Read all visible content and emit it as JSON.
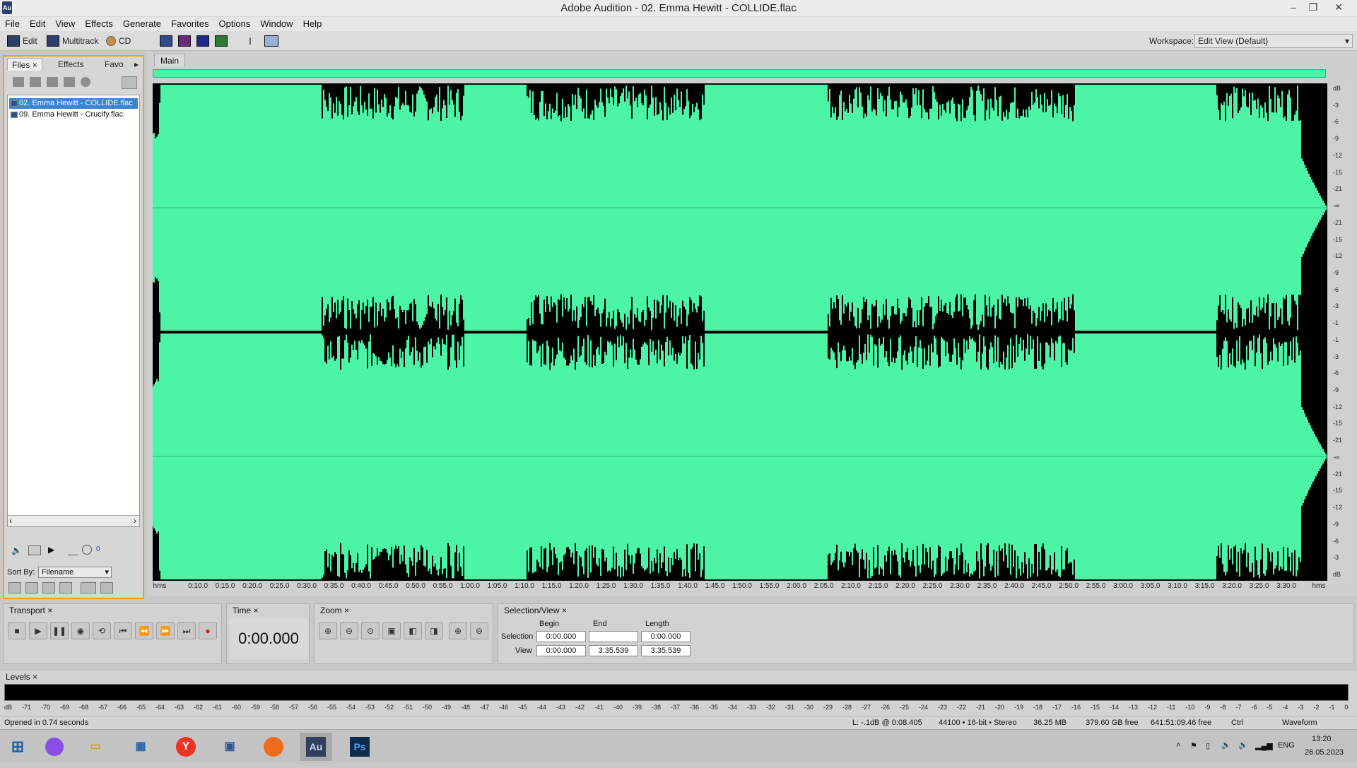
{
  "window": {
    "title": "Adobe Audition - 02. Emma Hewitt - COLLIDE.flac",
    "app_badge": "Au"
  },
  "menu": [
    "File",
    "Edit",
    "View",
    "Effects",
    "Generate",
    "Favorites",
    "Options",
    "Window",
    "Help"
  ],
  "toolbar": {
    "edit_label": "Edit",
    "multitrack_label": "Multitrack",
    "cd_label": "CD",
    "workspace_label": "Workspace:",
    "workspace_value": "Edit View (Default)"
  },
  "files_panel": {
    "tabs": [
      "Files",
      "Effects",
      "Favo"
    ],
    "files": [
      "02. Emma Hewitt - COLLIDE.flac",
      "09. Emma Hewitt - Crucify.flac"
    ],
    "sort_label": "Sort By:",
    "sort_value": "Filename",
    "volume_value": "0"
  },
  "main": {
    "tab": "Main",
    "db_ticks": [
      "dB",
      "-3",
      "-6",
      "-9",
      "-12",
      "-15",
      "-21",
      "-∞",
      "-21",
      "-15",
      "-12",
      "-9",
      "-6",
      "-3",
      "-1",
      "-1",
      "-3",
      "-6",
      "-9",
      "-12",
      "-15",
      "-21",
      "-∞",
      "-21",
      "-15",
      "-12",
      "-9",
      "-6",
      "-3",
      "dB"
    ],
    "time_ticks": [
      "hms",
      "0:10.0",
      "0:15.0",
      "0:20.0",
      "0:25.0",
      "0:30.0",
      "0:35.0",
      "0:40.0",
      "0:45.0",
      "0:50.0",
      "0:55.0",
      "1:00.0",
      "1:05.0",
      "1:10.0",
      "1:15.0",
      "1:20.0",
      "1:25.0",
      "1:30.0",
      "1:35.0",
      "1:40.0",
      "1:45.0",
      "1:50.0",
      "1:55.0",
      "2:00.0",
      "2:05.0",
      "2:10.0",
      "2:15.0",
      "2:20.0",
      "2:25.0",
      "2:30.0",
      "2:35.0",
      "2:40.0",
      "2:45.0",
      "2:50.0",
      "2:55.0",
      "3:00.0",
      "3:05.0",
      "3:10.0",
      "3:15.0",
      "3:20.0",
      "3:25.0",
      "3:30.0",
      "hms"
    ],
    "wave_color": "#4cf5a6"
  },
  "transport": {
    "title": "Transport"
  },
  "time": {
    "title": "Time",
    "value": "0:00.000"
  },
  "zoom": {
    "title": "Zoom"
  },
  "selection": {
    "title": "Selection/View",
    "col_begin": "Begin",
    "col_end": "End",
    "col_length": "Length",
    "row_selection": "Selection",
    "row_view": "View",
    "sel_begin": "0:00.000",
    "sel_end": "",
    "sel_length": "0:00.000",
    "view_begin": "0:00.000",
    "view_end": "3:35.539",
    "view_length": "3:35.539"
  },
  "levels": {
    "title": "Levels",
    "scale": [
      "dB",
      "-71",
      "-70",
      "-69",
      "-68",
      "-67",
      "-66",
      "-65",
      "-64",
      "-63",
      "-62",
      "-61",
      "-60",
      "-59",
      "-58",
      "-57",
      "-56",
      "-55",
      "-54",
      "-53",
      "-52",
      "-51",
      "-50",
      "-49",
      "-48",
      "-47",
      "-46",
      "-45",
      "-44",
      "-43",
      "-42",
      "-41",
      "-40",
      "-39",
      "-38",
      "-37",
      "-36",
      "-35",
      "-34",
      "-33",
      "-32",
      "-31",
      "-30",
      "-29",
      "-28",
      "-27",
      "-26",
      "-25",
      "-24",
      "-23",
      "-22",
      "-21",
      "-20",
      "-19",
      "-18",
      "-17",
      "-16",
      "-15",
      "-14",
      "-13",
      "-12",
      "-11",
      "-10",
      "-9",
      "-8",
      "-7",
      "-6",
      "-5",
      "-4",
      "-3",
      "-2",
      "-1",
      "0"
    ]
  },
  "status": {
    "message": "Opened in 0.74 seconds",
    "level": "L: -.1dB @  0:08.405",
    "format": "44100 • 16-bit • Stereo",
    "size": "36.25 MB",
    "free": "379.60 GB free",
    "free_time": "641:51:09.46 free",
    "modifier": "Ctrl",
    "view": "Waveform"
  },
  "taskbar": {
    "apps": [
      "Au",
      "Ps"
    ],
    "lang": "ENG",
    "time": "13:20",
    "date": "26.05.2023"
  }
}
